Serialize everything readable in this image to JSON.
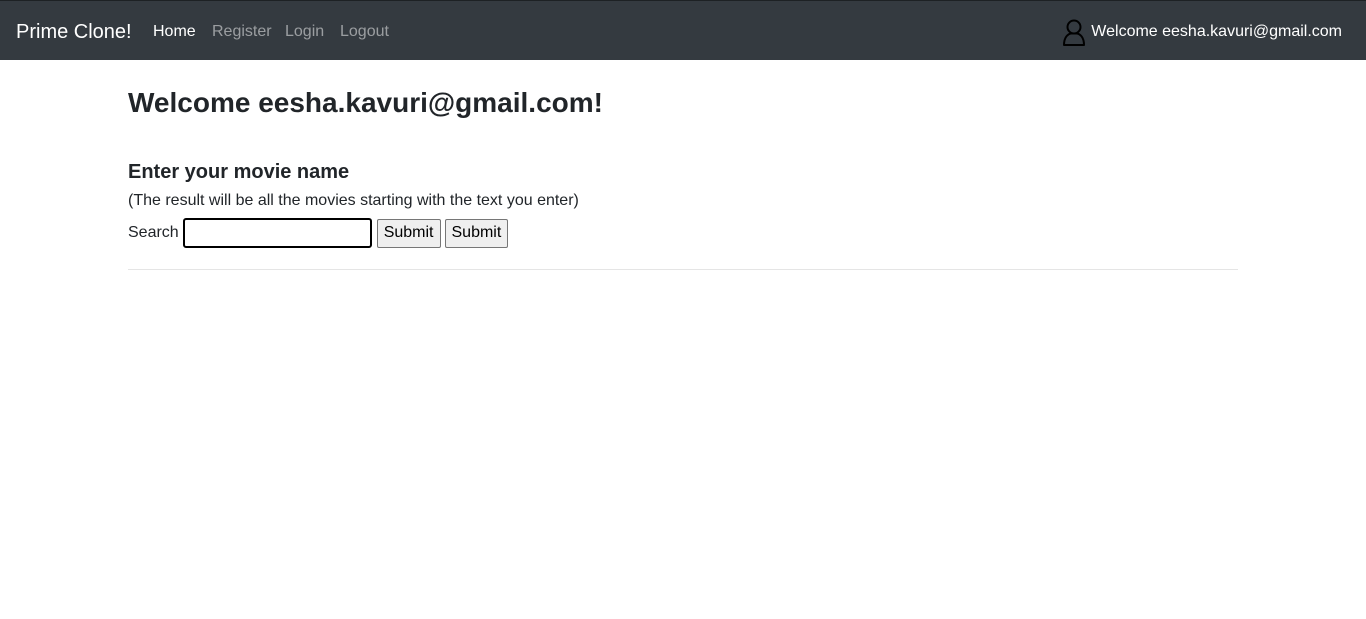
{
  "navbar": {
    "brand": "Prime Clone!",
    "links": [
      {
        "label": "Home",
        "active": true
      },
      {
        "label": "Register",
        "active": false
      },
      {
        "label": "Login",
        "active": false
      },
      {
        "label": "Logout",
        "active": false
      }
    ],
    "user_icon": "user-outline-icon",
    "user_welcome": "Welcome eesha.kavuri@gmail.com"
  },
  "main": {
    "title": "Welcome eesha.kavuri@gmail.com!",
    "section_heading": "Enter your movie name",
    "hint": "(The result will be all the movies starting with the text you enter)",
    "search": {
      "label": "Search",
      "value": "",
      "placeholder": "",
      "submit_label_1": "Submit",
      "submit_label_2": "Submit"
    }
  },
  "colors": {
    "navbar_bg": "#343a40",
    "nav_active": "#ffffff",
    "nav_inactive": "rgba(255,255,255,0.5)",
    "text": "#212529"
  }
}
